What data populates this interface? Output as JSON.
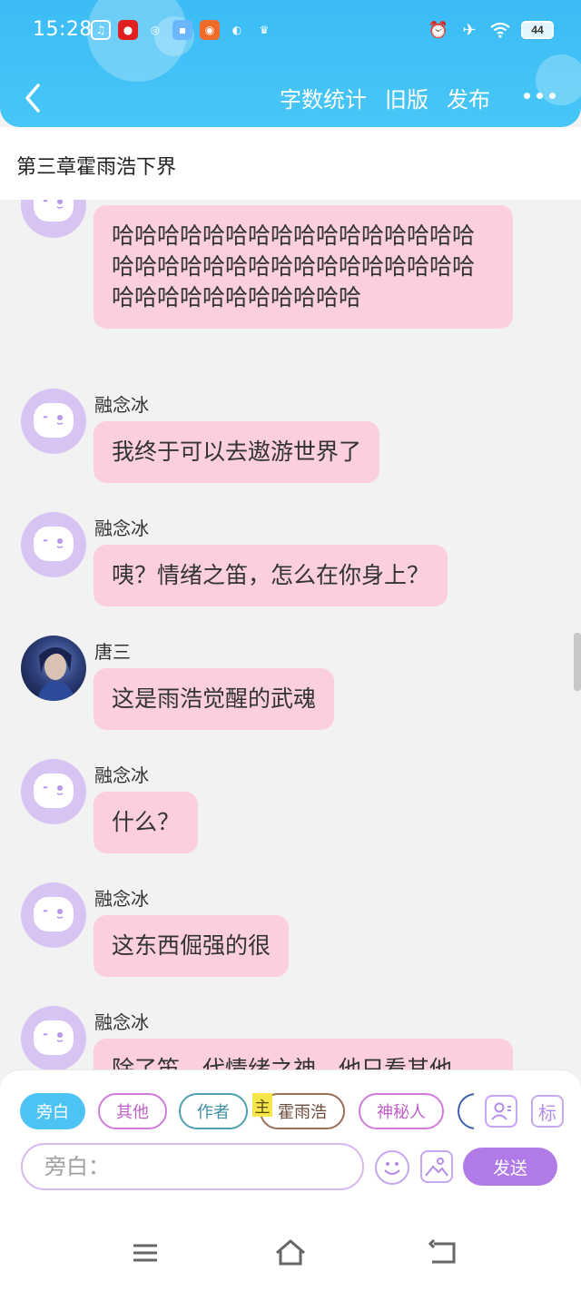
{
  "status_bar": {
    "time": "15:28",
    "battery": "44",
    "app_icons": [
      {
        "name": "music-app-icon",
        "color": "#ffffff",
        "glyph": "♫"
      },
      {
        "name": "red-app-icon",
        "color": "#e02020",
        "glyph": "●"
      },
      {
        "name": "wechat-icon",
        "color": "#ffffff",
        "glyph": "◎"
      },
      {
        "name": "blue-app-icon",
        "color": "#6ab7ff",
        "glyph": "▪"
      },
      {
        "name": "orange-app-icon",
        "color": "#f06a2a",
        "glyph": "◉"
      },
      {
        "name": "compass-icon",
        "color": "#ffffff",
        "glyph": "◐"
      },
      {
        "name": "crown-icon",
        "color": "#ffffff",
        "glyph": "♛"
      }
    ]
  },
  "header": {
    "actions": [
      "字数统计",
      "旧版",
      "发布"
    ]
  },
  "chapter": {
    "title": "第三章霍雨浩下界"
  },
  "messages": [
    {
      "sender": "",
      "text": "哈哈哈哈哈哈哈哈哈哈哈哈哈哈哈哈哈哈哈哈哈哈哈哈哈哈哈哈哈哈哈哈哈哈哈哈哈哈哈哈哈哈哈",
      "avatar": "default"
    },
    {
      "sender": "融念冰",
      "text": "我终于可以去遨游世界了",
      "avatar": "default"
    },
    {
      "sender": "融念冰",
      "text": "咦？情绪之笛，怎么在你身上？",
      "avatar": "default"
    },
    {
      "sender": "唐三",
      "text": "这是雨浩觉醒的武魂",
      "avatar": "photo"
    },
    {
      "sender": "融念冰",
      "text": "什么？",
      "avatar": "default"
    },
    {
      "sender": "融念冰",
      "text": "这东西倔强的很",
      "avatar": "default"
    },
    {
      "sender": "融念冰",
      "text": "除了笛，代情绪之神，他只看其他",
      "avatar": "default"
    }
  ],
  "composer": {
    "roles": [
      "旁白",
      "其他",
      "作者",
      "霍雨浩",
      "神秘人"
    ],
    "main_badge": "主",
    "input_placeholder": "旁白：",
    "send_label": "发送",
    "tag_button": "标"
  },
  "colors": {
    "header": "#3bbcf5",
    "bubble": "#fbd0dc",
    "accent_purple": "#b07be6",
    "active_role": "#4cc3f3"
  }
}
